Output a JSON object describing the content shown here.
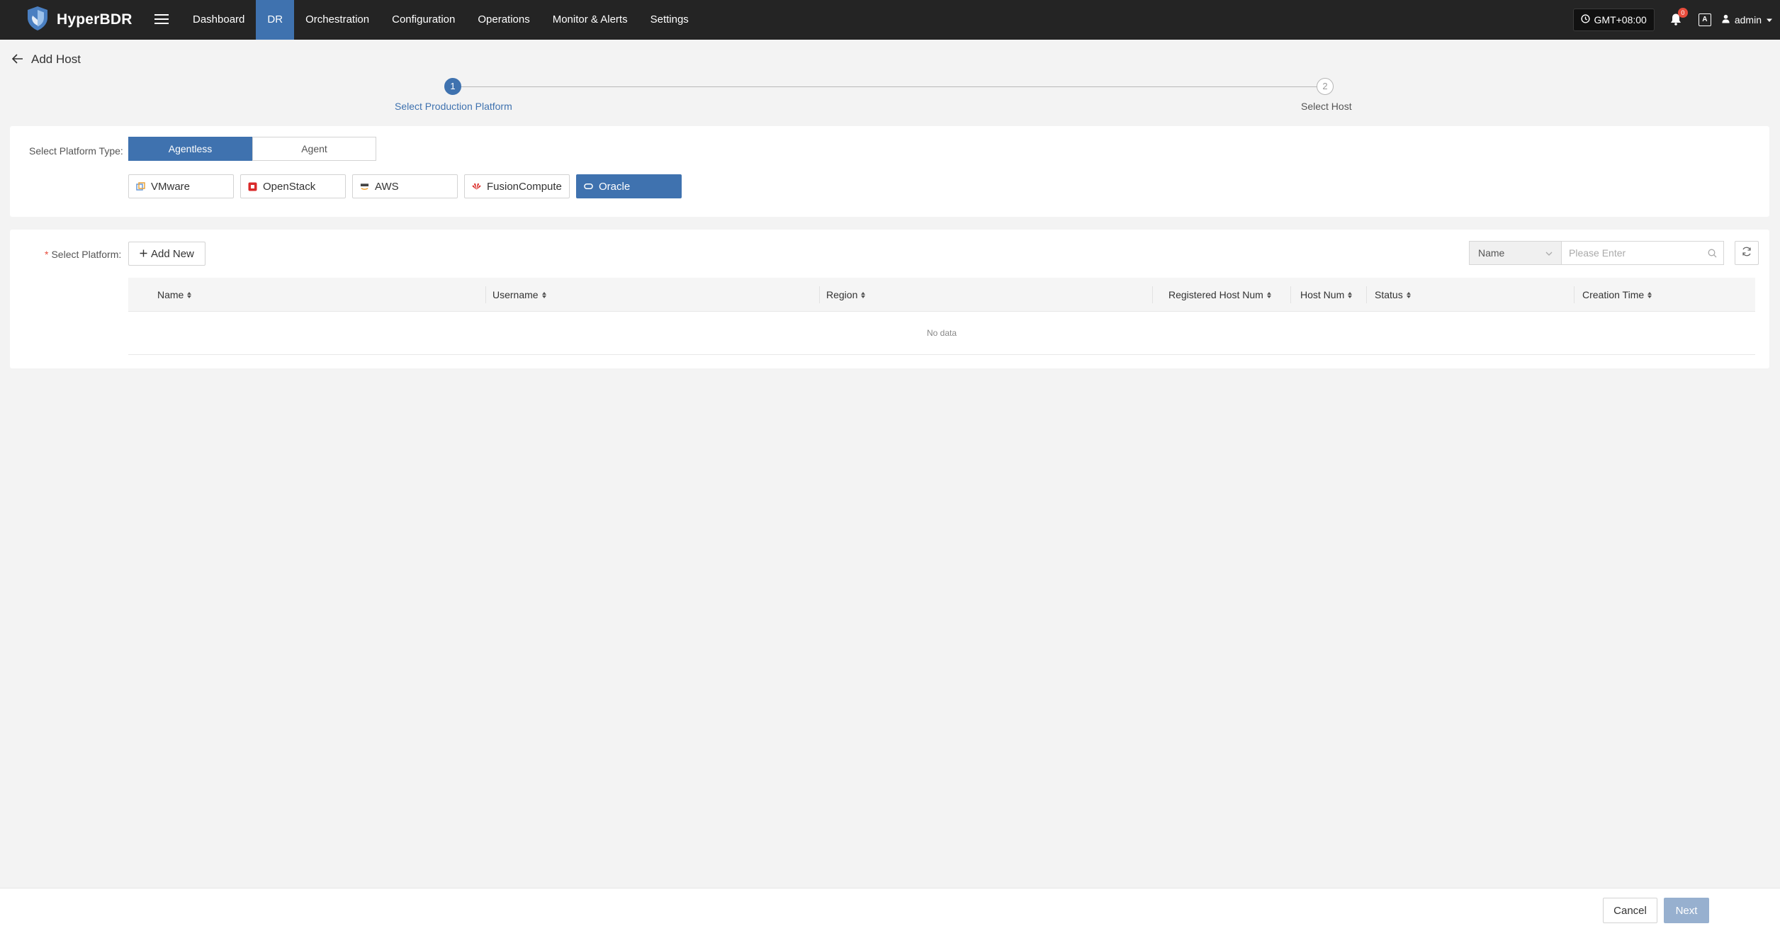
{
  "app": {
    "brand": "HyperBDR"
  },
  "nav": [
    {
      "label": "Dashboard",
      "active": false
    },
    {
      "label": "DR",
      "active": true
    },
    {
      "label": "Orchestration",
      "active": false
    },
    {
      "label": "Configuration",
      "active": false
    },
    {
      "label": "Operations",
      "active": false
    },
    {
      "label": "Monitor & Alerts",
      "active": false
    },
    {
      "label": "Settings",
      "active": false
    }
  ],
  "topbar": {
    "timezone": "GMT+08:00",
    "notification_count": "0",
    "lang_icon": "A",
    "user": "admin"
  },
  "page": {
    "title": "Add Host"
  },
  "steps": [
    {
      "number": "1",
      "label": "Select Production Platform",
      "status": "active"
    },
    {
      "number": "2",
      "label": "Select Host",
      "status": "pending"
    }
  ],
  "platform_type": {
    "label": "Select Platform Type:",
    "options": [
      "Agentless",
      "Agent"
    ],
    "selected": "Agentless"
  },
  "platforms": [
    {
      "label": "VMware",
      "icon": "vmware-icon"
    },
    {
      "label": "OpenStack",
      "icon": "openstack-icon"
    },
    {
      "label": "AWS",
      "icon": "aws-icon"
    },
    {
      "label": "FusionCompute",
      "icon": "huawei-icon"
    },
    {
      "label": "Oracle",
      "icon": "oracle-icon"
    }
  ],
  "selected_platform": "Oracle",
  "select_platform": {
    "label": "Select Platform:",
    "add_new": "Add New",
    "search_field": "Name",
    "search_placeholder": "Please Enter"
  },
  "table": {
    "columns": [
      "Name",
      "Username",
      "Region",
      "Registered Host Num",
      "Host Num",
      "Status",
      "Creation Time"
    ],
    "empty_text": "No data"
  },
  "footer": {
    "cancel": "Cancel",
    "next": "Next"
  },
  "colors": {
    "accent": "#3f72af",
    "topbar": "#242424",
    "disabled": "#97b0cf",
    "required": "#e74c3c"
  }
}
